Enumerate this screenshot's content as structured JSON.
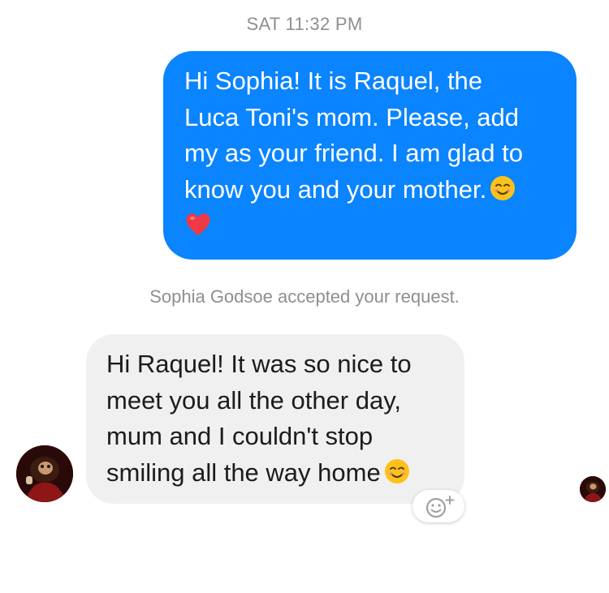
{
  "conversation": {
    "timestamp": "SAT 11:32 PM",
    "outgoing_message": {
      "lines": [
        "Hi Sophia! It is Raquel, the",
        "Luca Toni's mom. Please, add",
        "my as your friend. I am glad to",
        "know you and your mother."
      ],
      "trailing_emoji": "smiling-face-icon",
      "second_line_emoji": "red-heart-icon",
      "bubble_color": "#0a84ff"
    },
    "system_note": "Sophia Godsoe accepted your request.",
    "incoming_message": {
      "lines": [
        "Hi Raquel! It was so nice to",
        "meet you all the other day,",
        "mum and I couldn't stop",
        "smiling all the way home"
      ],
      "trailing_emoji": "smiling-face-icon",
      "bubble_color": "#f0f0f0"
    },
    "sender_avatar": "avatar-icon",
    "read_receipt_avatar": "avatar-icon",
    "reaction_button_icon": "add-reaction-icon"
  }
}
